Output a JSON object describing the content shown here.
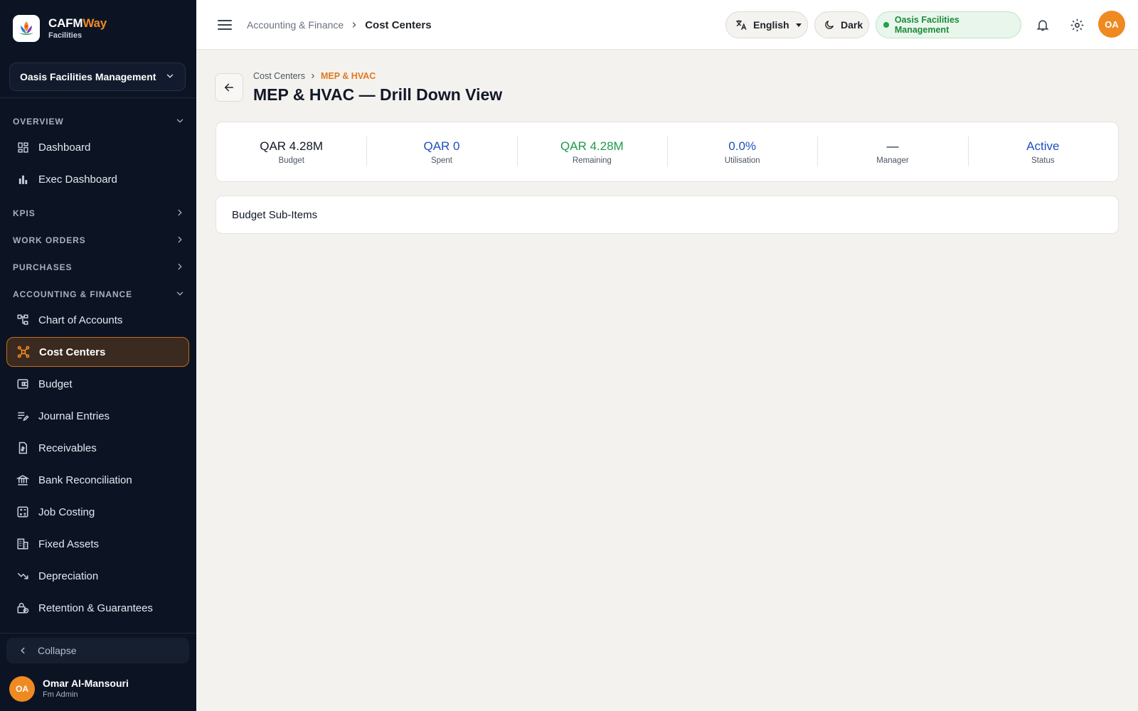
{
  "brand": {
    "name_part1": "CAFM",
    "name_part2": "Way",
    "subtitle": "Facilities",
    "accent_color": "#f08a24"
  },
  "sidebar": {
    "org_selector": "Oasis Facilities Management",
    "sections": {
      "overview": "OVERVIEW",
      "kpis": "KPIS",
      "work_orders": "WORK ORDERS",
      "purchases": "PURCHASES",
      "accounting": "ACCOUNTING & FINANCE"
    },
    "overview_items": [
      {
        "label": "Dashboard",
        "icon": "dashboard-icon"
      },
      {
        "label": "Exec Dashboard",
        "icon": "bar-chart-icon"
      }
    ],
    "accounting_items": [
      {
        "label": "Chart of Accounts",
        "icon": "account-tree-icon"
      },
      {
        "label": "Cost Centers",
        "icon": "hub-icon",
        "active": true
      },
      {
        "label": "Budget",
        "icon": "wallet-icon"
      },
      {
        "label": "Journal Entries",
        "icon": "edit-note-icon"
      },
      {
        "label": "Receivables",
        "icon": "receipt-icon"
      },
      {
        "label": "Bank Reconciliation",
        "icon": "bank-icon"
      },
      {
        "label": "Job Costing",
        "icon": "calculator-icon"
      },
      {
        "label": "Fixed Assets",
        "icon": "building-icon"
      },
      {
        "label": "Depreciation",
        "icon": "trending-down-icon"
      },
      {
        "label": "Retention & Guarantees",
        "icon": "lock-clock-icon"
      }
    ],
    "collapse_label": "Collapse",
    "user": {
      "initials": "OA",
      "name": "Omar Al-Mansouri",
      "role": "Fm Admin"
    },
    "bg_color": "#0c1424"
  },
  "topbar": {
    "breadcrumb_parent": "Accounting & Finance",
    "breadcrumb_current": "Cost Centers",
    "language": "English",
    "theme": "Dark",
    "org_badge": "Oasis Facilities Management",
    "avatar_initials": "OA"
  },
  "page": {
    "crumb_parent": "Cost Centers",
    "crumb_current": "MEP & HVAC",
    "title": "MEP & HVAC — Drill Down View",
    "stats": [
      {
        "value": "QAR 4.28M",
        "label": "Budget"
      },
      {
        "value": "QAR 0",
        "label": "Spent"
      },
      {
        "value": "QAR 4.28M",
        "label": "Remaining"
      },
      {
        "value": "0.0%",
        "label": "Utilisation"
      },
      {
        "value": "—",
        "label": "Manager"
      },
      {
        "value": "Active",
        "label": "Status"
      }
    ],
    "subitems_title": "Budget Sub-Items"
  }
}
